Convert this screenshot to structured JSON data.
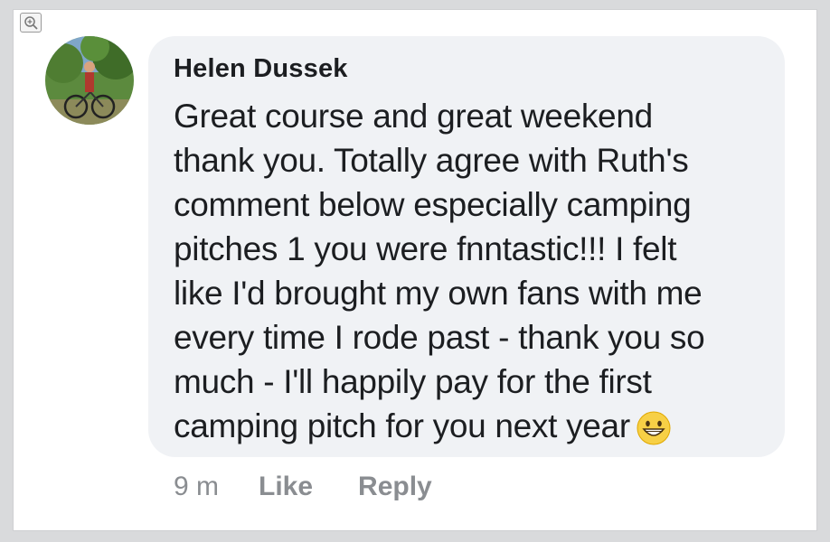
{
  "comment": {
    "author": "Helen Dussek",
    "lines": [
      "Great course and great weekend",
      "thank you. Totally agree with Ruth's",
      "comment below  especially camping",
      "pitches 1 you were fnntastic!!! I felt",
      "like I'd brought my own fans with me",
      "every time I rode past - thank you so",
      "much - I'll happily pay for the first",
      "camping pitch for you next year"
    ],
    "emoji": "grinning-face-icon"
  },
  "actions": {
    "time": "9 m",
    "like": "Like",
    "reply": "Reply"
  },
  "colors": {
    "bubble": "#f0f2f5",
    "text": "#1c1e21",
    "muted": "#8a8d91"
  }
}
